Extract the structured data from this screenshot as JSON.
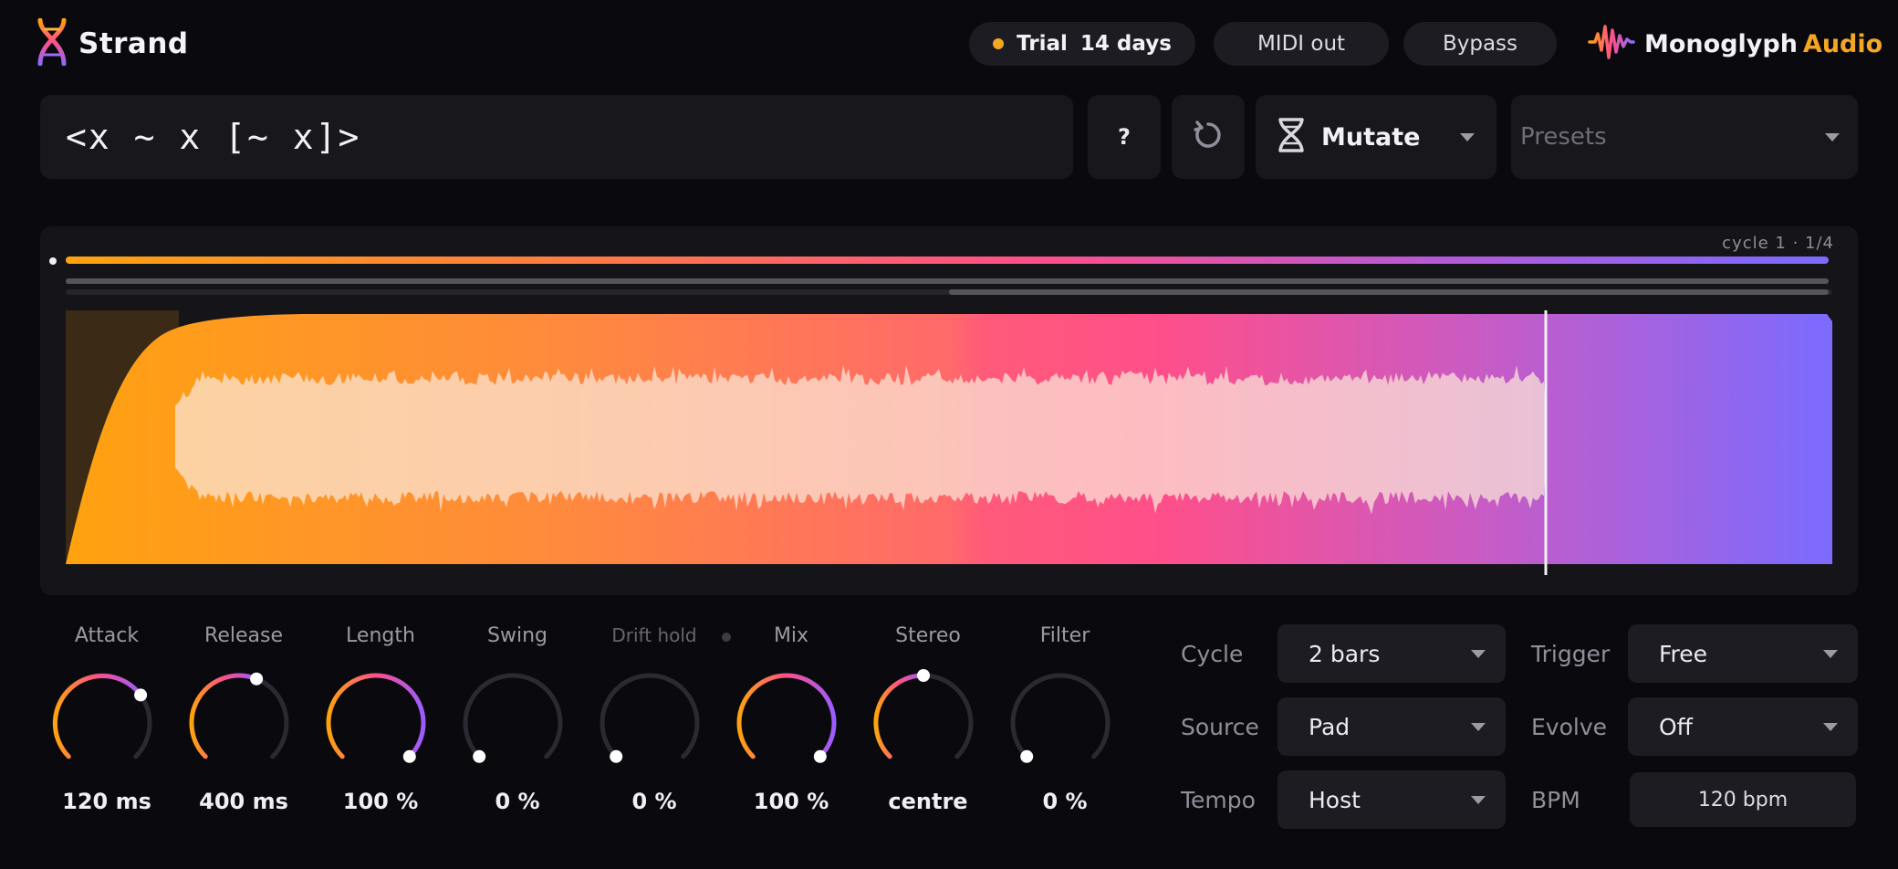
{
  "header": {
    "app_name": "Strand",
    "trial_label": "Trial",
    "trial_days": "14 days",
    "midi_out": "MIDI out",
    "bypass": "Bypass",
    "vendor_name": "Monoglyph",
    "vendor_accent": "Audio"
  },
  "pattern": {
    "text": "<x ~ x  [~ x]>"
  },
  "toolbar": {
    "help_label": "?",
    "mutate_label": "Mutate",
    "presets_placeholder": "Presets"
  },
  "waveform": {
    "cycle_info": "cycle 1 · 1/4",
    "progress": 1.0,
    "playhead_fraction": 0.838
  },
  "knobs": [
    {
      "label": "Attack",
      "value": "120 ms",
      "level": 0.7,
      "active": true
    },
    {
      "label": "Release",
      "value": "400 ms",
      "level": 0.58,
      "active": true
    },
    {
      "label": "Length",
      "value": "100 %",
      "level": 1.0,
      "active": true
    },
    {
      "label": "Swing",
      "value": "0 %",
      "level": 0.0,
      "active": false
    },
    {
      "label": "Drift hold",
      "value": "0 %",
      "level": 0.0,
      "active": false
    },
    {
      "label": "Mix",
      "value": "100 %",
      "level": 1.0,
      "active": true
    },
    {
      "label": "Stereo",
      "value": "centre",
      "level": 0.5,
      "active": true
    },
    {
      "label": "Filter",
      "value": "0 %",
      "level": 0.0,
      "active": false
    }
  ],
  "settings": {
    "cycle": {
      "label": "Cycle",
      "value": "2 bars"
    },
    "source": {
      "label": "Source",
      "value": "Pad"
    },
    "tempo": {
      "label": "Tempo",
      "value": "Host"
    },
    "trigger": {
      "label": "Trigger",
      "value": "Free"
    },
    "evolve": {
      "label": "Evolve",
      "value": "Off"
    },
    "bpm": {
      "label": "BPM",
      "value": "120 bpm"
    }
  },
  "colors": {
    "accent_orange": "#ffa20f",
    "accent_pink": "#ff4f8a",
    "accent_violet": "#7b6bff",
    "background": "#0a0a0e"
  }
}
